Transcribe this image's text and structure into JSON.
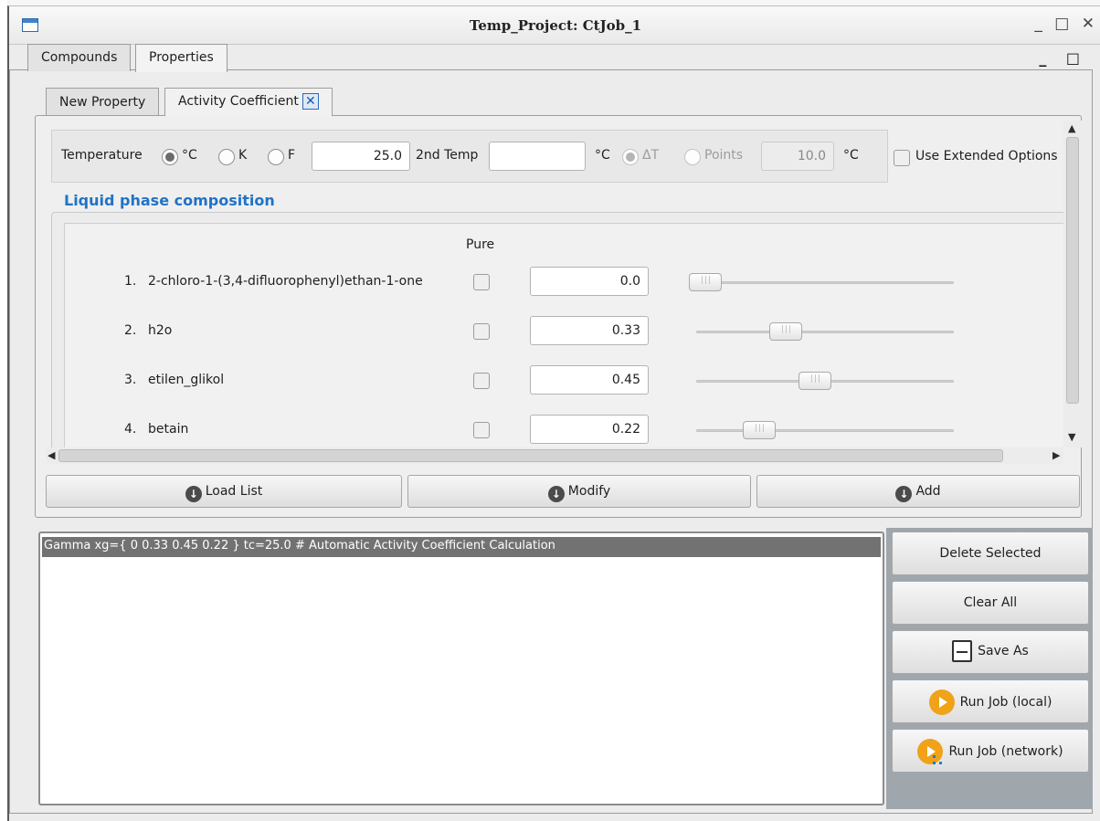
{
  "window": {
    "title": "Temp_Project: CtJob_1",
    "controls": "_ □ ✕"
  },
  "outer_tabs": [
    "Compounds",
    "Properties"
  ],
  "panel_controls": "_ □",
  "inner_tabs": {
    "new_property": "New Property",
    "activity_coefficient": "Activity Coefficient",
    "close_glyph": "✕"
  },
  "temperature": {
    "label": "Temperature",
    "unit_options": [
      "°C",
      "K",
      "F"
    ],
    "selected_unit": "°C",
    "value": "25.0",
    "second_temp_label": "2nd Temp",
    "second_temp_value": "",
    "second_temp_unit": "°C",
    "mode_options": [
      "ΔT",
      "Points"
    ],
    "selected_mode": "ΔT",
    "points_value": "10.0",
    "points_unit": "°C",
    "extended_options_label": "Use Extended Options"
  },
  "composition": {
    "title": "Liquid phase composition",
    "pure_header": "Pure",
    "rows": [
      {
        "index": "1.",
        "name": "2-chloro-1-(3,4-difluorophenyl)ethan-1-one",
        "value": "0.0",
        "fraction": 0.0
      },
      {
        "index": "2.",
        "name": "h2o",
        "value": "0.33",
        "fraction": 0.33
      },
      {
        "index": "3.",
        "name": "etilen_glikol",
        "value": "0.45",
        "fraction": 0.45
      },
      {
        "index": "4.",
        "name": "betain",
        "value": "0.22",
        "fraction": 0.22
      }
    ]
  },
  "actions": {
    "load_list": "Load List",
    "modify": "Modify",
    "add": "Add"
  },
  "job_list": [
    "Gamma  xg={ 0 0.33 0.45 0.22 }  tc=25.0 # Automatic Activity Coefficient Calculation"
  ],
  "side_buttons": {
    "delete_selected": "Delete Selected",
    "clear_all": "Clear All",
    "save_as": "Save As",
    "run_local": "Run Job (local)",
    "run_network": "Run Job (network)"
  },
  "colors": {
    "section_title": "#1f73c7",
    "run_icon": "#f0a219",
    "selected_row": "#727272",
    "side_panel": "#9fa7ad"
  }
}
